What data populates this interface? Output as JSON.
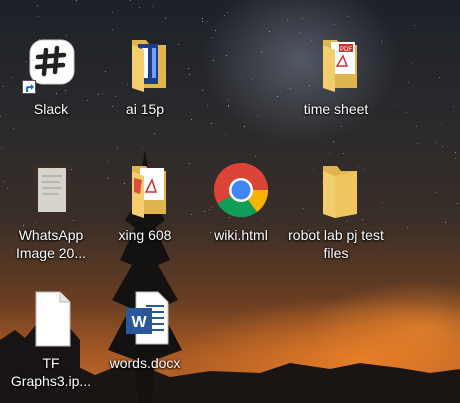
{
  "desktop": {
    "icons": [
      {
        "label": "Slack",
        "icon": "slack-icon"
      },
      {
        "label": "ai 15p",
        "icon": "folder-icon"
      },
      {
        "label": "time sheet",
        "icon": "folder-icon"
      },
      {
        "label": "WhatsApp Image 20...",
        "icon": "image-file-icon"
      },
      {
        "label": "xing 608",
        "icon": "folder-icon"
      },
      {
        "label": "wiki.html",
        "icon": "chrome-icon"
      },
      {
        "label": "robot lab pj test files",
        "icon": "folder-icon"
      },
      {
        "label": "TF Graphs3.ip...",
        "icon": "blank-file-icon"
      },
      {
        "label": "words.docx",
        "icon": "word-doc-icon"
      }
    ]
  },
  "colors": {
    "folder": "#f3cd6e",
    "chrome_red": "#db4437",
    "chrome_green": "#0f9d58",
    "chrome_yellow": "#f4b400",
    "chrome_blue": "#4285f4",
    "word_blue": "#2b579a",
    "pdf_red": "#d32f2f"
  }
}
